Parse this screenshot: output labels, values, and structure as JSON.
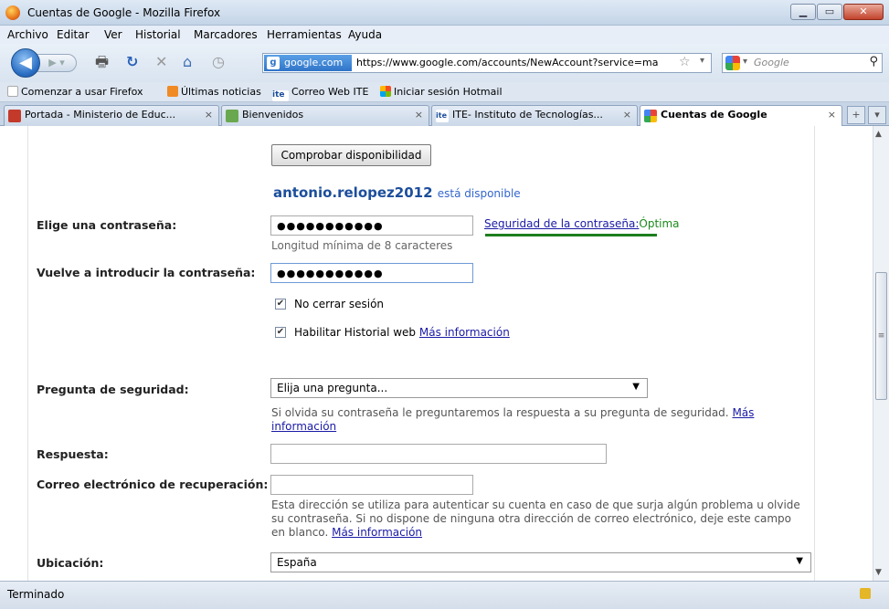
{
  "window": {
    "title": "Cuentas de Google - Mozilla Firefox"
  },
  "menu": [
    "Archivo",
    "Editar",
    "Ver",
    "Historial",
    "Marcadores",
    "Herramientas",
    "Ayuda"
  ],
  "nav": {
    "site_chip": "google.com",
    "url": "https://www.google.com/accounts/NewAccount?service=ma",
    "search_placeholder": "Google"
  },
  "bookmarks": [
    "Comenzar a usar Firefox",
    "Últimas noticias",
    "Correo Web ITE",
    "Iniciar sesión Hotmail"
  ],
  "tabs": [
    {
      "label": "Portada - Ministerio de Educ..."
    },
    {
      "label": "Bienvenidos"
    },
    {
      "label": "ITE- Instituto de Tecnologías..."
    },
    {
      "label": "Cuentas de Google"
    }
  ],
  "form": {
    "check_button": "Comprobar disponibilidad",
    "available_user": "antonio.relopez2012",
    "available_msg": "está disponible",
    "password_label": "Elige una contraseña:",
    "password_value": "●●●●●●●●●●●",
    "password_hint": "Longitud mínima de 8 caracteres",
    "strength_label": "Seguridad de la contraseña:",
    "strength_value": "Óptima",
    "repeat_label": "Vuelve a introducir la contraseña:",
    "repeat_value": "●●●●●●●●●●●",
    "stay_signed": "No cerrar sesión",
    "web_history": "Habilitar Historial web",
    "more_info": "Más información",
    "question_label": "Pregunta de seguridad:",
    "question_value": "Elija una pregunta...",
    "question_help": "Si olvida su contraseña le preguntaremos la respuesta a su pregunta de seguridad.",
    "question_more_1": "Más",
    "question_more_2": "información",
    "answer_label": "Respuesta:",
    "answer_value": "",
    "recovery_label": "Correo electrónico de recuperación:",
    "recovery_value": "",
    "recovery_help_1": "Esta dirección se utiliza para autenticar su cuenta en caso de que surja algún problema u olvide",
    "recovery_help_2": "su contraseña. Si no dispone de ninguna otra dirección de correo electrónico, deje este campo",
    "recovery_help_3": "en blanco.",
    "recovery_more": "Más información",
    "location_label": "Ubicación:",
    "location_value": "España"
  },
  "status": {
    "text": "Terminado"
  }
}
